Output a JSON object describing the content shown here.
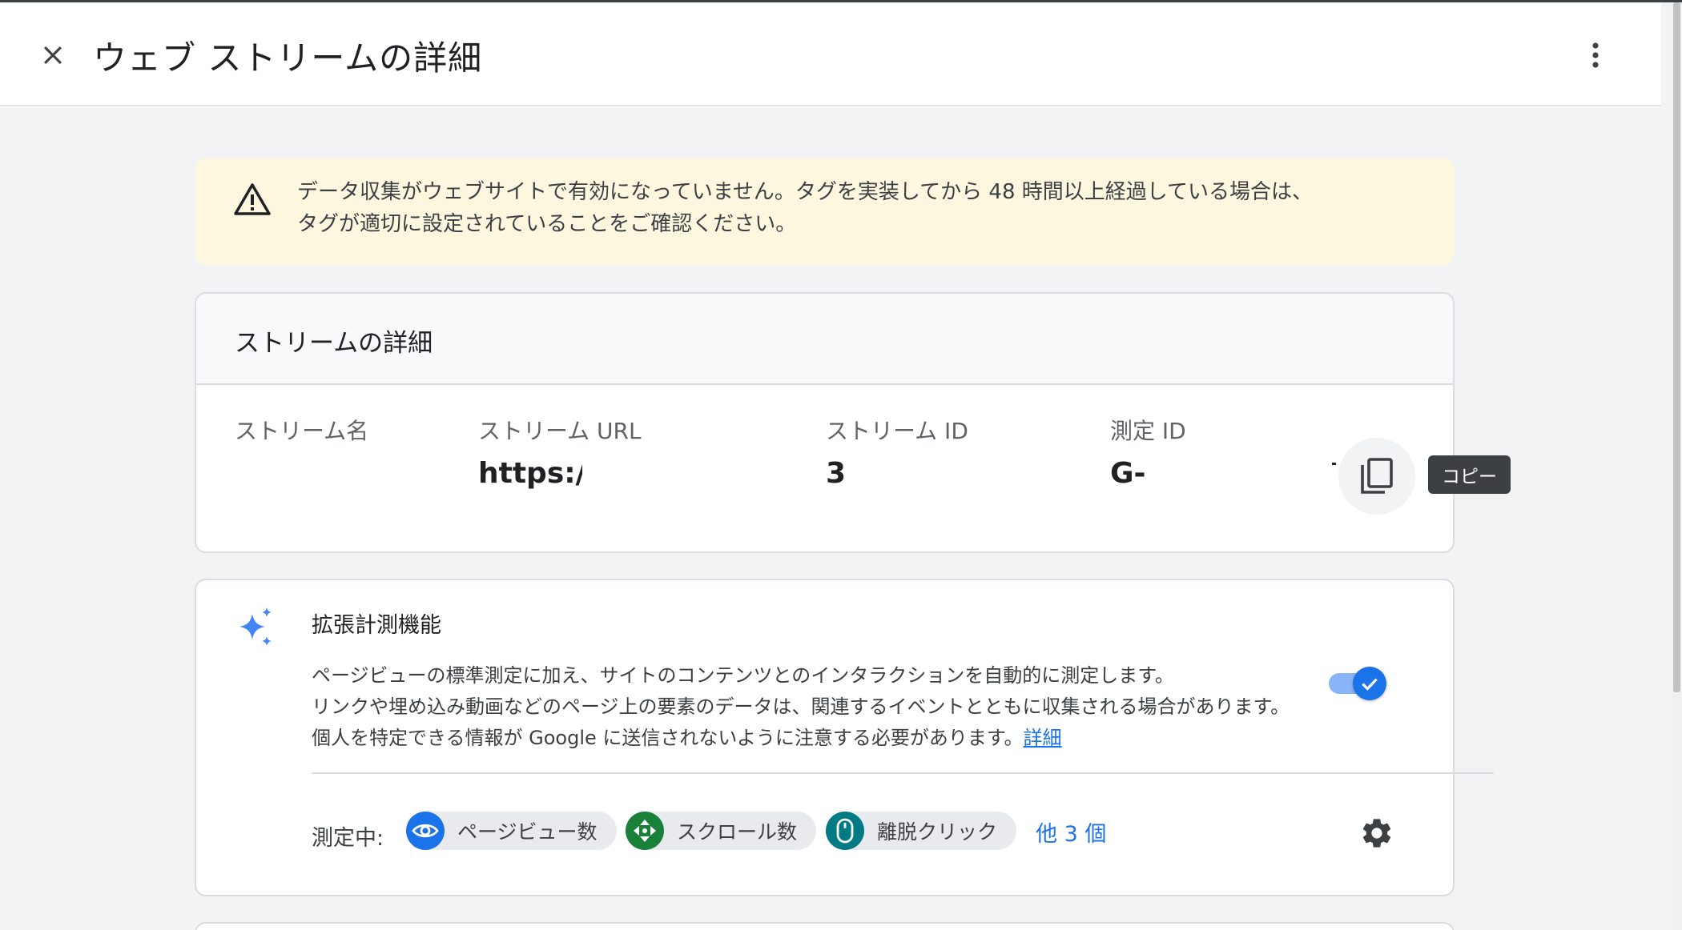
{
  "header": {
    "title": "ウェブ ストリームの詳細"
  },
  "warning": {
    "line1": "データ収集がウェブサイトで有効になっていません。タグを実装してから 48 時間以上経過している場合は、",
    "line2": "タグが適切に設定されていることをご確認ください。"
  },
  "stream_details": {
    "title": "ストリームの詳細",
    "fields": [
      {
        "label": "ストリーム名",
        "value": ""
      },
      {
        "label": "ストリーム URL",
        "value": "https://"
      },
      {
        "label": "ストリーム ID",
        "value": "3"
      },
      {
        "label": "測定 ID",
        "value": "G-"
      }
    ],
    "copy_tooltip": "コピー"
  },
  "enhanced": {
    "title": "拡張計測機能",
    "desc_line1": "ページビューの標準測定に加え、サイトのコンテンツとのインタラクションを自動的に測定します。",
    "desc_line2": "リンクや埋め込み動画などのページ上の要素のデータは、関連するイベントとともに収集される場合があります。",
    "desc_line3": "個人を特定できる情報が Google に送信されないように注意する必要があります。",
    "link": "詳細",
    "toggle_on": true,
    "measuring_label": "測定中:",
    "chips": [
      {
        "label": "ページビュー数",
        "color": "#1a73e8",
        "icon": "eye-icon"
      },
      {
        "label": "スクロール数",
        "color": "#188038",
        "icon": "scroll-arrows-icon"
      },
      {
        "label": "離脱クリック",
        "color": "#007b83",
        "icon": "mouse-icon"
      }
    ],
    "more": "他 3 個"
  },
  "colors": {
    "accent": "#1a73e8",
    "warning_bg": "#fef7e0",
    "page_bg": "#f1f3f4"
  }
}
